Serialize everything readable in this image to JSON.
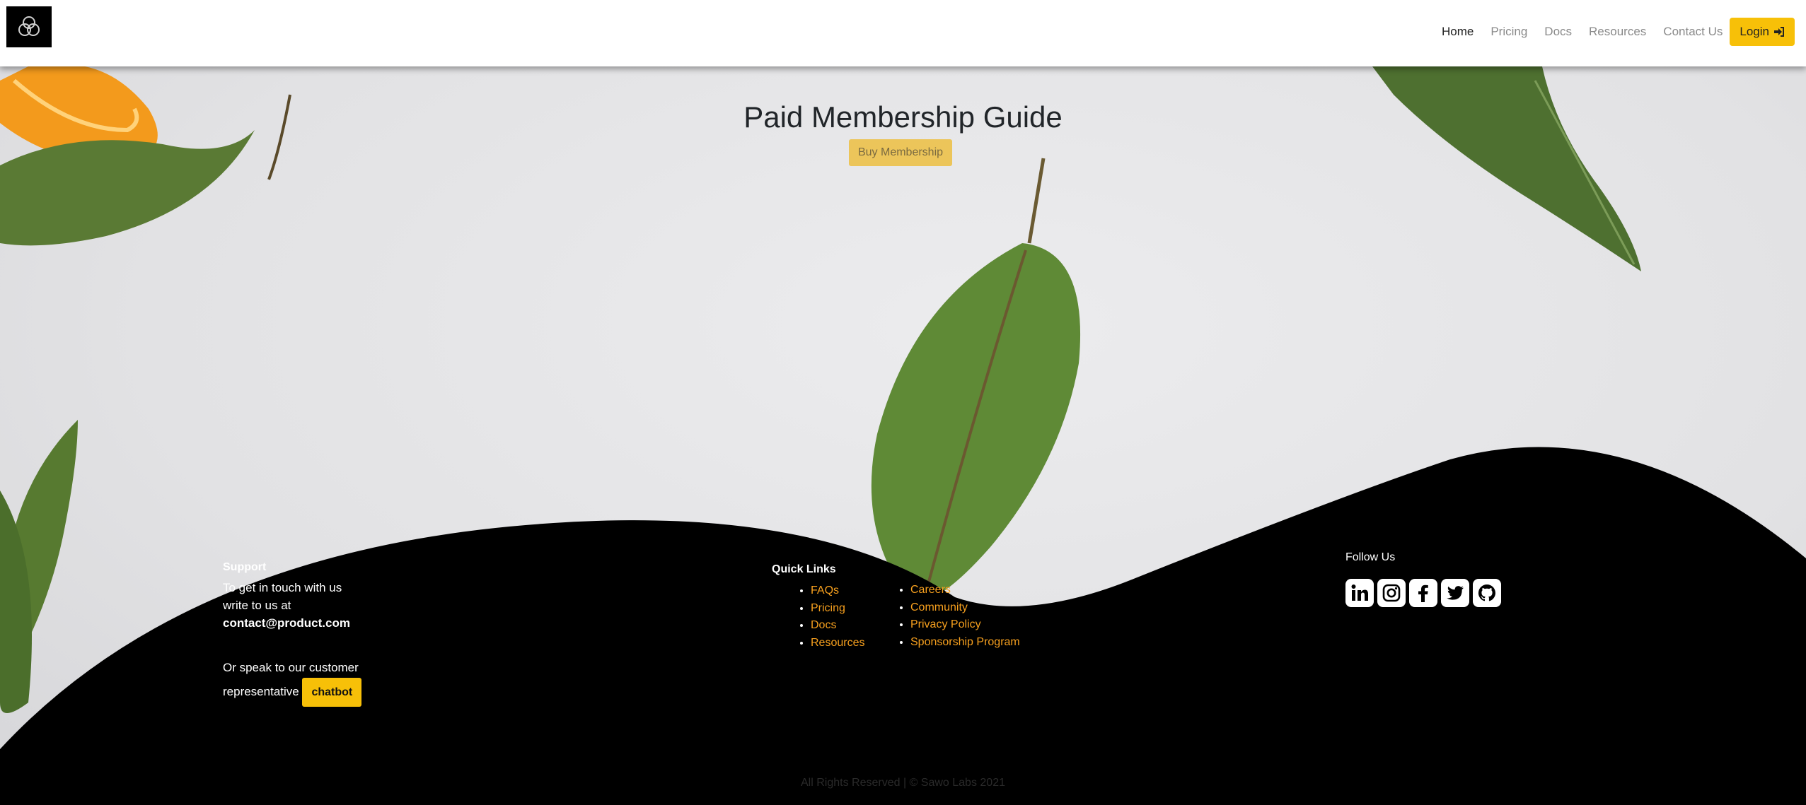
{
  "nav": {
    "links": [
      "Home",
      "Pricing",
      "Docs",
      "Resources",
      "Contact Us"
    ],
    "login_label": "Login"
  },
  "hero": {
    "title": "Paid Membership Guide",
    "button_label": "Buy Membership"
  },
  "footer": {
    "support": {
      "heading": "Support",
      "line1": "To get in touch with us",
      "line2": "write to us at",
      "email": "contact@product.com",
      "line3": "Or speak to our customer",
      "line4": "representative",
      "chatbot_label": "chatbot"
    },
    "quick_links": {
      "heading": "Quick Links",
      "col1": [
        "FAQs",
        "Pricing",
        "Docs",
        "Resources"
      ],
      "col2": [
        "Careers",
        "Community",
        "Privacy Policy",
        "Sponsorship Program"
      ]
    },
    "follow": {
      "heading": "Follow Us",
      "icons": [
        "linkedin-icon",
        "instagram-icon",
        "facebook-icon",
        "twitter-icon",
        "github-icon"
      ]
    },
    "copyright": "All Rights Reserved | © Sawo Labs 2021"
  },
  "colors": {
    "accent": "#f7c008",
    "link": "#f7a01e",
    "footer_bg": "#000000"
  }
}
